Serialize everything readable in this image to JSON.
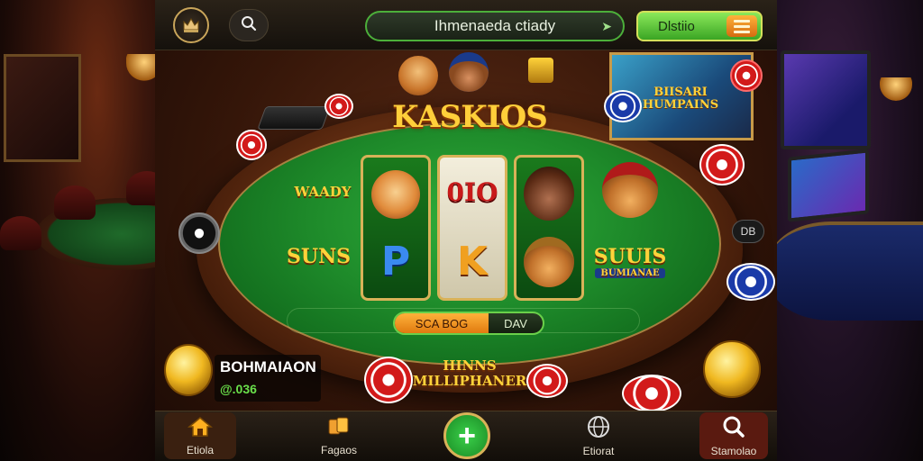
{
  "header": {
    "title": "Ihmenaeda ctiady",
    "action_label": "Dlstiio",
    "logo_icon": "crown-badge-icon",
    "search_icon": "search-icon"
  },
  "hero": {
    "title": "KASKIOS"
  },
  "slots": {
    "left_badge": "WAADY",
    "left_badge_2": "SUNS",
    "right_badge": "SUUIS",
    "right_badge_sub": "BUMIANAE",
    "reel1_letter": "P",
    "reel2_letter": "K",
    "reel_top_mid": "0IO"
  },
  "spin_bar": {
    "left_label": "SCA BOG",
    "right_label": "DAV"
  },
  "poster": {
    "text": "BIISARI HUMPAINS"
  },
  "center_text": "HINNS MILLIPHANER",
  "balance": {
    "name": "BOHMAIAON",
    "amount": "@.036"
  },
  "side_pill": "DB",
  "nav": {
    "home": "Etiola",
    "games": "Fagaos",
    "wallet": "Etiorat",
    "search": "Stamolao"
  },
  "colors": {
    "felt": "#1e8a2a",
    "accent_gold": "#ffcf3a",
    "accent_green": "#4caf3a",
    "accent_orange": "#e07a10"
  }
}
